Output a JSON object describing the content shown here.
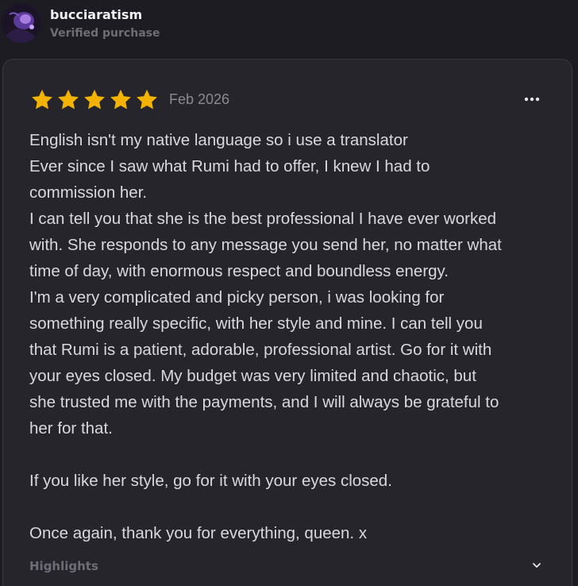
{
  "reviewer": {
    "name": "bucciaratism",
    "badge": "Verified purchase",
    "avatar_icon": "user-avatar"
  },
  "review": {
    "rating": 5,
    "max_rating": 5,
    "date": "Feb 2026",
    "star_color": "#f5b301",
    "menu_icon": "more-horizontal-icon",
    "lines": [
      "English isn't my native language so i use a translator",
      "Ever since I saw what Rumi had to offer, I knew I had to",
      "commission her.",
      "I can tell you that she is the best professional I have ever worked",
      "with. She responds to any message you send her, no matter what",
      "time of day, with enormous respect and boundless energy.",
      "I'm a very complicated and picky person, i was looking for",
      "something really specific, with her style and mine. I can tell you",
      "that Rumi is a patient, adorable, professional artist. Go for it with",
      "your eyes closed. My budget was very limited and chaotic, but",
      "she trusted me with the payments, and I will always be grateful to",
      "her for that."
    ],
    "paragraph_2": "If you like her style, go for it with your eyes closed.",
    "paragraph_3": "Once again, thank you for everything, queen. x"
  },
  "highlights": {
    "label": "Highlights",
    "toggle_icon": "chevron-down-icon"
  }
}
